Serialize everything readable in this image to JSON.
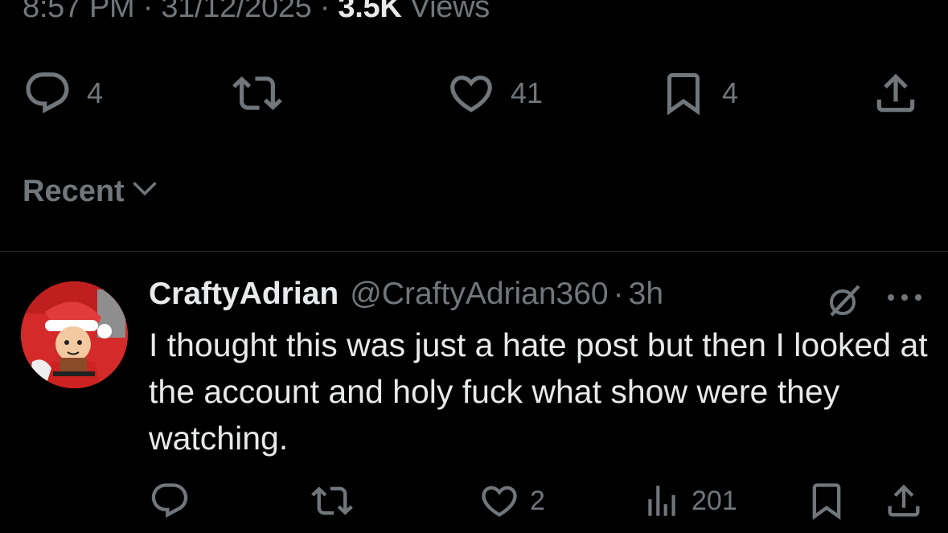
{
  "post": {
    "time": "8:57 PM",
    "separator": "·",
    "date": "31/12/2025",
    "views_count": "3.5K",
    "views_label": "Views",
    "actions": {
      "reply_count": "4",
      "repost_count": "",
      "like_count": "41",
      "bookmark_count": "4"
    }
  },
  "replies_sort": {
    "label": "Recent"
  },
  "reply": {
    "display_name": "CraftyAdrian",
    "handle": "@CraftyAdrian360",
    "separator": "·",
    "age": "3h",
    "text": "I thought this was just a hate post but then I looked at the account and holy fuck what show were they watching.",
    "actions": {
      "reply_count": "",
      "repost_count": "",
      "like_count": "2",
      "views_count": "201"
    }
  },
  "colors": {
    "background": "#000000",
    "text_primary": "#e7e9ea",
    "text_secondary": "#71767b",
    "divider": "#2f3336",
    "avatar_red": "#d42a2a"
  },
  "icons": {
    "reply": "speech-bubble-icon",
    "repost": "repost-arrows-icon",
    "like": "heart-icon",
    "bookmark": "bookmark-icon",
    "share": "share-upload-icon",
    "views": "bar-chart-icon",
    "grok": "grok-slash-icon",
    "more": "ellipsis-icon",
    "sort": "chevron-down-icon"
  }
}
